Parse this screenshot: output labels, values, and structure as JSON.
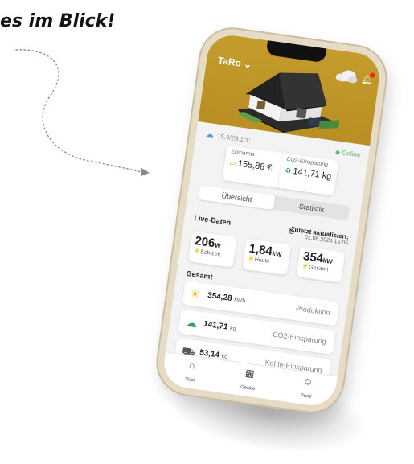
{
  "headline": "es im Blick!",
  "app": {
    "name": "TaRo",
    "weather": "15.4/29.1°C",
    "status": "Online"
  },
  "summary": {
    "savings_label": "Ersparnis",
    "savings_value": "155,88 €",
    "co2_label": "CO2-Einsparung",
    "co2_value": "141,71 kg"
  },
  "tabs": [
    {
      "label": "Übersicht",
      "active": true
    },
    {
      "label": "Statistik",
      "active": false
    }
  ],
  "live": {
    "title": "Live-Daten",
    "updated_label": "Zuletzt aktualisiert:",
    "updated_value": "01.08.2024 16:05",
    "cards": [
      {
        "value": "206",
        "unit": "W",
        "label": "Echtzeit"
      },
      {
        "value": "1,84",
        "unit": "kW",
        "label": "Heute"
      },
      {
        "value": "354",
        "unit": "kW",
        "label": "Gesamt"
      }
    ]
  },
  "total": {
    "title": "Gesamt",
    "rows": [
      {
        "icon": "sun-icon",
        "value": "354,28",
        "unit": "kWh",
        "name": "Produktion"
      },
      {
        "icon": "cloud-leaf-icon",
        "value": "141,71",
        "unit": "kg",
        "name": "CO2-Einsparung"
      },
      {
        "icon": "coal-cart-icon",
        "value": "53,14",
        "unit": "kg",
        "name": "Kohle-Einsparung"
      }
    ]
  },
  "nav": [
    {
      "icon": "home-icon",
      "label": "Start"
    },
    {
      "icon": "devices-icon",
      "label": "Geräte"
    },
    {
      "icon": "profile-icon",
      "label": "Profil"
    }
  ],
  "colors": {
    "brand_gold": "#c49c2c",
    "accent_yellow": "#e0a800",
    "online_green": "#4cbb72"
  }
}
